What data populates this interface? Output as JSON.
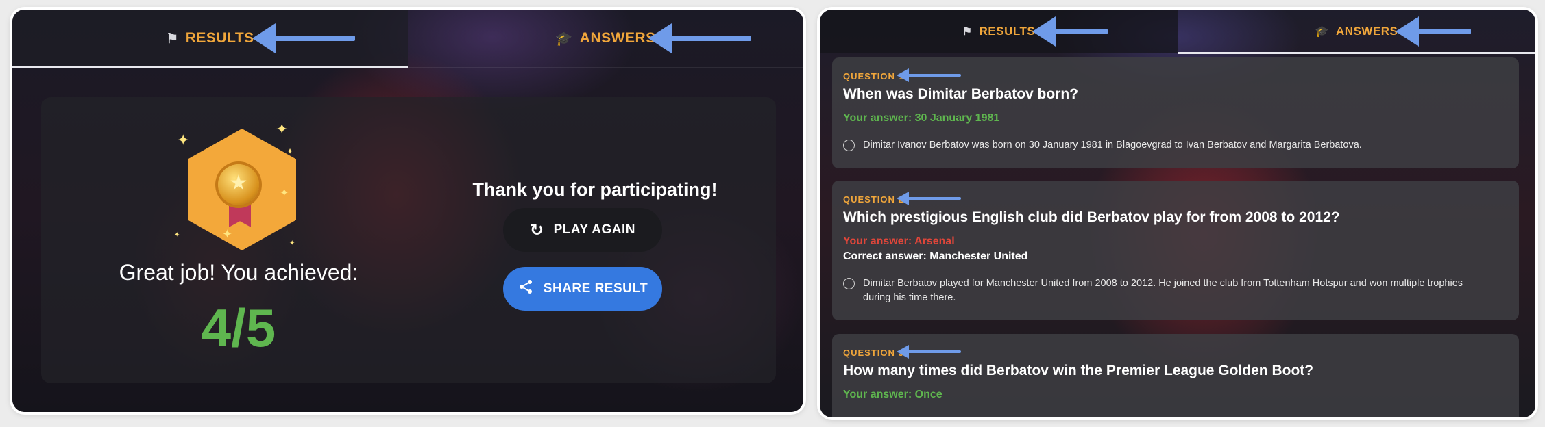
{
  "left": {
    "tabs": [
      {
        "label": "RESULTS",
        "icon": "flag-checkered-icon",
        "active": true
      },
      {
        "label": "ANSWERS",
        "icon": "graduation-cap-icon",
        "active": false
      }
    ],
    "great_job": "Great job! You achieved:",
    "score": "4/5",
    "thank_you": "Thank you for participating!",
    "play_again": "PLAY AGAIN",
    "share_result": "SHARE RESULT"
  },
  "right": {
    "tabs": [
      {
        "label": "RESULTS",
        "icon": "flag-checkered-icon",
        "active": false
      },
      {
        "label": "ANSWERS",
        "icon": "graduation-cap-icon",
        "active": true
      }
    ],
    "questions": [
      {
        "label": "QUESTION 1",
        "title": "When was Dimitar Berbatov born?",
        "your_answer": "Your answer: 30 January 1981",
        "explanation": "Dimitar Ivanov Berbatov was born on 30 January 1981 in Blagoevgrad to Ivan Berbatov and Margarita Berbatova."
      },
      {
        "label": "QUESTION 2",
        "title": "Which prestigious English club did Berbatov play for from 2008 to 2012?",
        "your_answer": "Your answer: Arsenal",
        "correct_answer": "Correct answer: Manchester United",
        "explanation": "Dimitar Berbatov played for Manchester United from 2008 to 2012. He joined the club from Tottenham Hotspur and won multiple trophies during his time there."
      },
      {
        "label": "QUESTION 3",
        "title": "How many times did Berbatov win the Premier League Golden Boot?",
        "your_answer": "Your answer: Once"
      }
    ]
  },
  "colors": {
    "accent": "#f0a63b",
    "correct": "#5fb64f",
    "wrong": "#e0463a",
    "share": "#3579e0",
    "annotation_arrow": "#6f9be9"
  }
}
